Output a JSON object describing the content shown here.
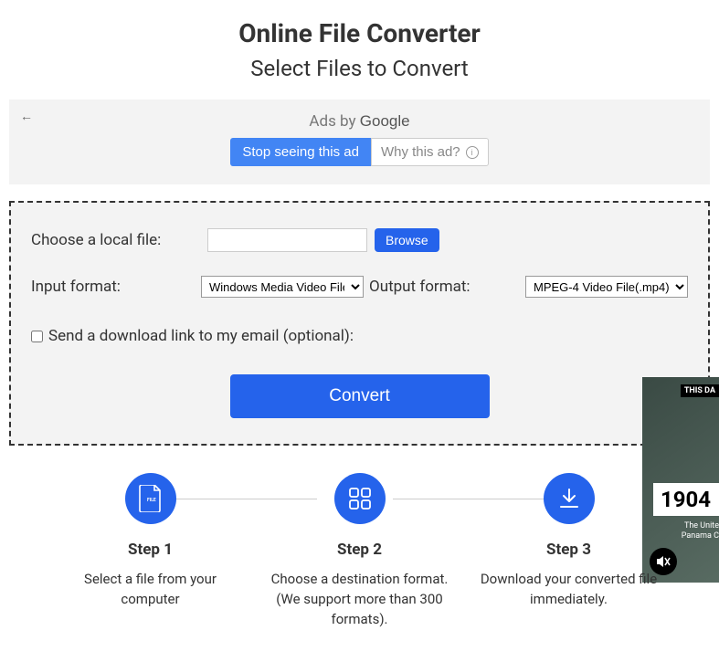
{
  "header": {
    "title": "Online File Converter",
    "subtitle": "Select Files to Convert"
  },
  "ad": {
    "label_prefix": "Ads by ",
    "label_brand": "Google",
    "stop_label": "Stop seeing this ad",
    "why_label": "Why this ad?"
  },
  "form": {
    "local_file_label": "Choose a local file:",
    "browse_label": "Browse",
    "input_format_label": "Input format:",
    "input_format_value": "Windows Media Video File(.wmv)",
    "output_format_label": "Output format:",
    "output_format_value": "MPEG-4 Video File(.mp4)",
    "email_checkbox_label": "Send a download link to my email (optional):",
    "convert_label": "Convert"
  },
  "steps": [
    {
      "title": "Step 1",
      "desc": "Select a file from your computer"
    },
    {
      "title": "Step 2",
      "desc": "Choose a destination format. (We support more than 300 formats)."
    },
    {
      "title": "Step 3",
      "desc": "Download your converted file immediately."
    }
  ],
  "side": {
    "tag": "THIS DA",
    "year": "1904",
    "blurb": "The Unite\nPanama C"
  }
}
